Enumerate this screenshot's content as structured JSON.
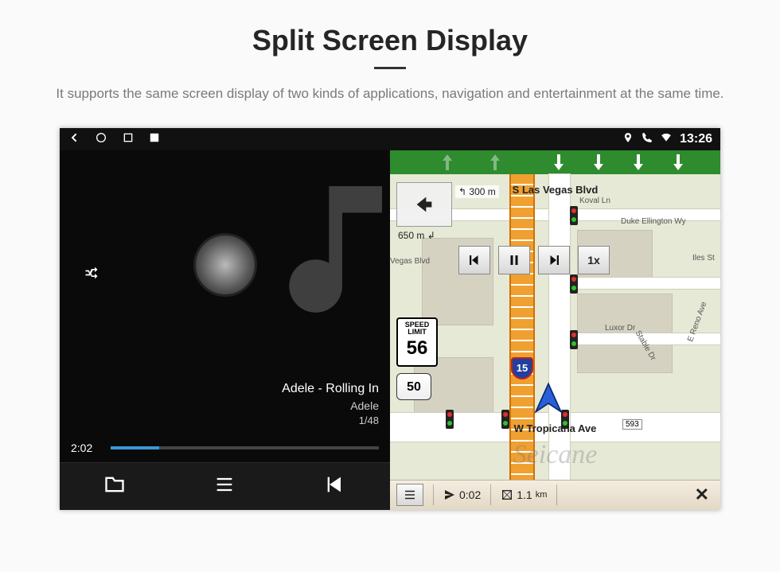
{
  "page": {
    "title": "Split Screen Display",
    "subtitle": "It supports the same screen display of two kinds of applications, navigation and entertainment at the same time."
  },
  "statusbar": {
    "time": "13:26"
  },
  "music": {
    "track_title": "Adele - Rolling In",
    "track_artist": "Adele",
    "track_index": "1/48",
    "elapsed": "2:02"
  },
  "map": {
    "top_street": "S Las Vegas Blvd",
    "bottom_street": "W Tropicana Ave",
    "next_turn_in": "300 m",
    "distance_shown": "650 m",
    "speed_btn": "1x",
    "speed_limit_label": "SPEED LIMIT",
    "speed_limit_value": "56",
    "hwy_num": "50",
    "interstate_num": "15",
    "label_vegas": "Vegas Blvd",
    "label_koval": "Koval Ln",
    "label_duke": "Duke Ellington Wy",
    "label_luxor": "Luxor Dr",
    "label_reno": "E Reno Ave",
    "label_stable": "Stable Dr",
    "label_iles": "Iles St",
    "label_593": "593",
    "bottom_time": "0:02",
    "bottom_dist": "1.1",
    "bottom_dist_unit": "km",
    "close_label": "✕"
  },
  "watermark": "Seicane"
}
